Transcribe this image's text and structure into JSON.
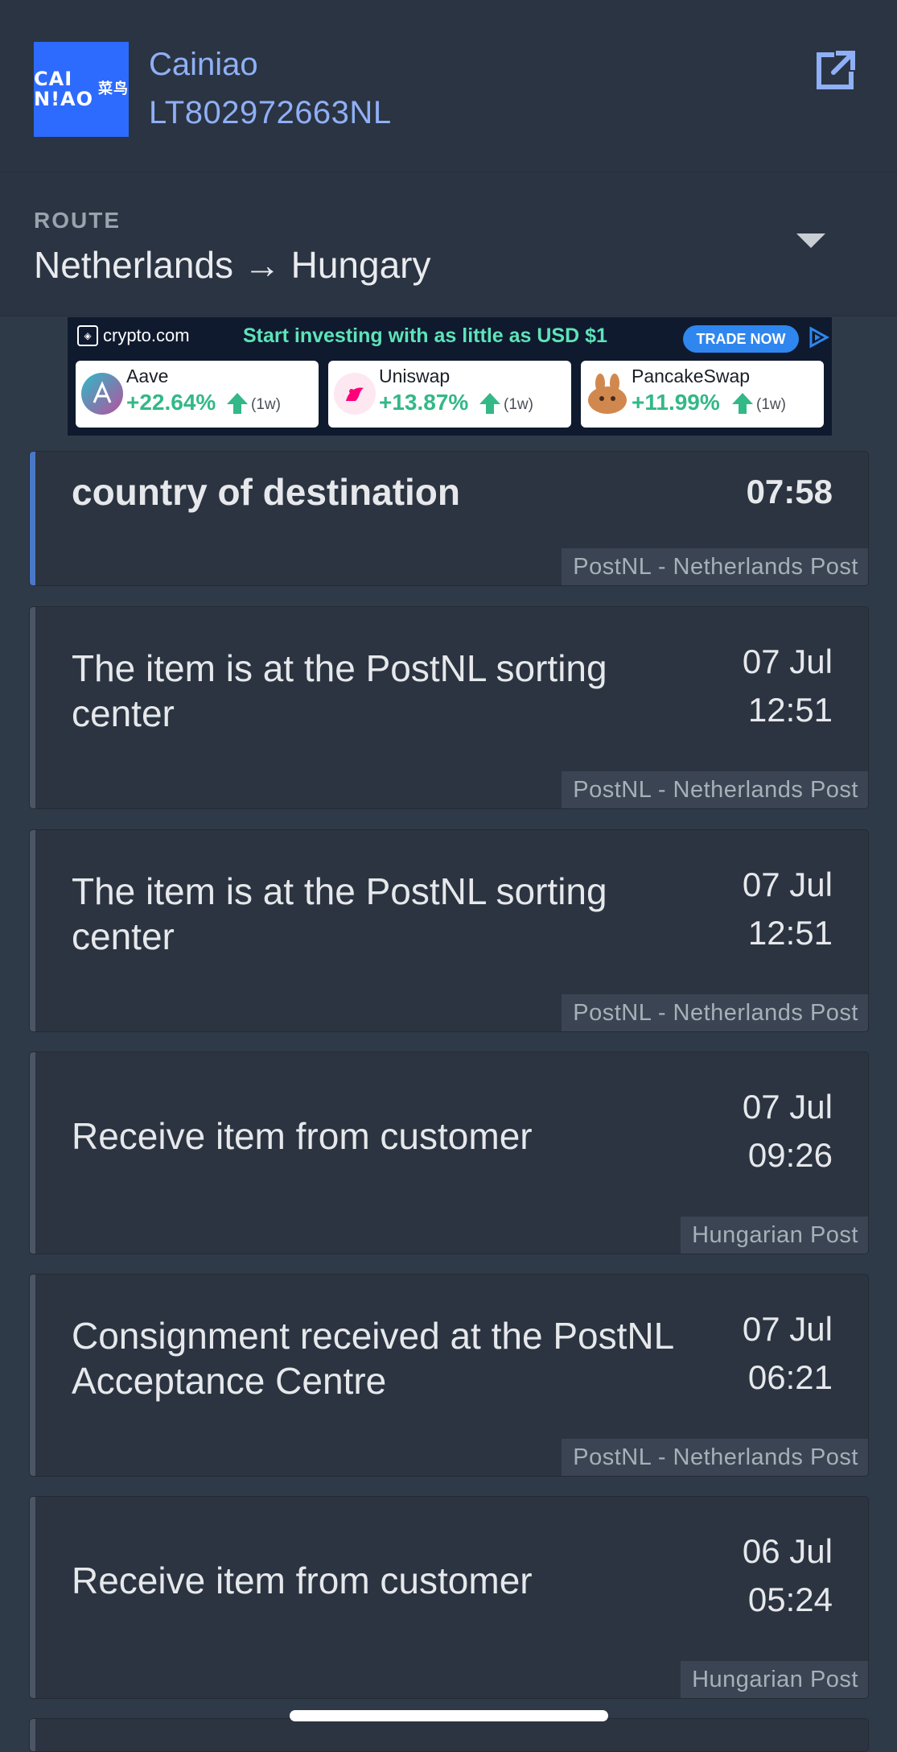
{
  "header": {
    "logo_text_line1": "CAI",
    "logo_text_line2": "N!AO",
    "logo_cn": "菜鸟",
    "carrier": "Cainiao",
    "tracking_number": "LT802972663NL",
    "open_icon": "external-link-icon",
    "accent": "#8fb0f6"
  },
  "route": {
    "label": "ROUTE",
    "value": "Netherlands → Hungary"
  },
  "ad": {
    "brand": "crypto.com",
    "headline": "Start investing with as little as USD $1",
    "cta": "TRADE NOW",
    "coins": [
      {
        "name": "Aave",
        "change": "+22.64%",
        "period": "(1w)"
      },
      {
        "name": "Uniswap",
        "change": "+13.87%",
        "period": "(1w)"
      },
      {
        "name": "PancakeSwap",
        "change": "+11.99%",
        "period": "(1w)"
      }
    ]
  },
  "events": [
    {
      "description": "country of destination",
      "date": "",
      "time": "07:58",
      "source": "PostNL - Netherlands Post"
    },
    {
      "description": "The item is at the PostNL sorting center",
      "date": "07 Jul",
      "time": "12:51",
      "source": "PostNL - Netherlands Post"
    },
    {
      "description": "The item is at the PostNL sorting center",
      "date": "07 Jul",
      "time": "12:51",
      "source": "PostNL - Netherlands Post"
    },
    {
      "description": "Receive item from customer",
      "date": "07 Jul",
      "time": "09:26",
      "source": "Hungarian Post"
    },
    {
      "description": "Consignment received at the PostNL Acceptance Centre",
      "date": "07 Jul",
      "time": "06:21",
      "source": "PostNL - Netherlands Post"
    },
    {
      "description": "Receive item from customer",
      "date": "06 Jul",
      "time": "05:24",
      "source": "Hungarian Post"
    }
  ]
}
